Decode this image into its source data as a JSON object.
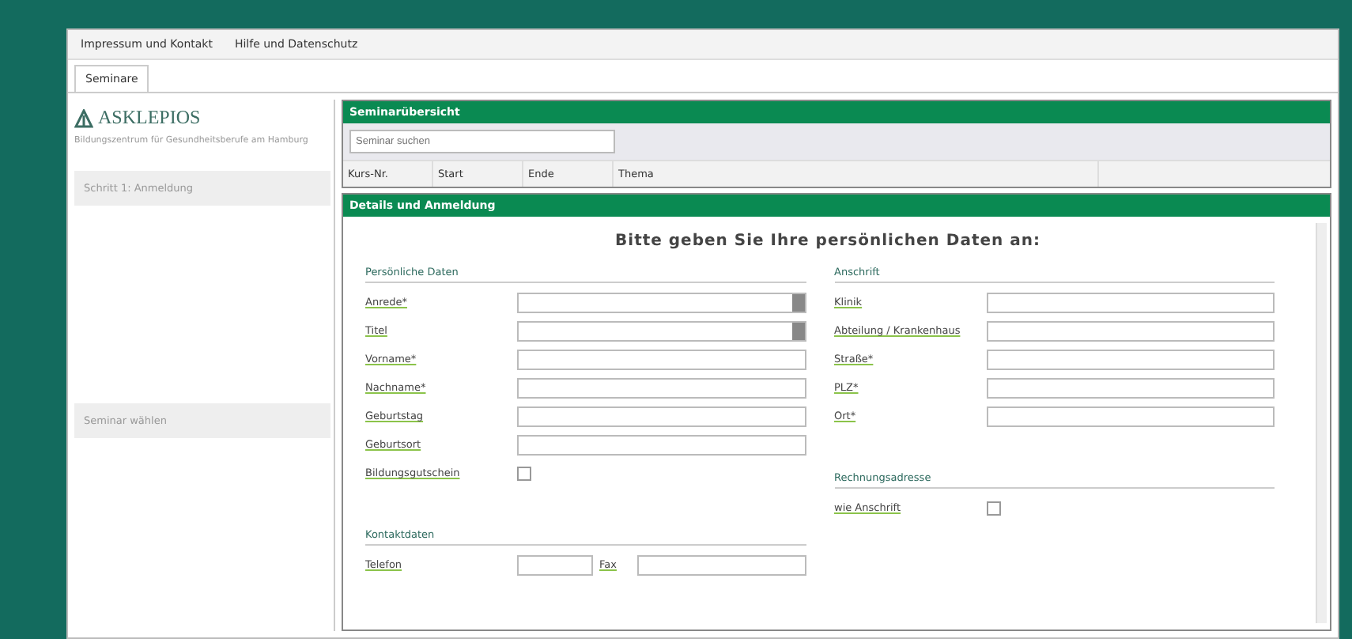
{
  "top_links": [
    "Impressum und Kontakt",
    "Hilfe und Datenschutz"
  ],
  "tabs": [
    {
      "label": "Seminare",
      "selected": true
    }
  ],
  "sidebar": {
    "logo": "ASKLEPIOS",
    "subtitle": "Bildungszentrum für Gesundheitsberufe am Hamburg",
    "sections": [
      "Schritt 1: Anmeldung",
      "Seminar wählen"
    ]
  },
  "seminars": {
    "title": "Seminarübersicht",
    "search": {
      "placeholder": "Seminar suchen"
    },
    "columns": [
      "Kurs-Nr.",
      "Start",
      "Ende",
      "Thema"
    ]
  },
  "details": {
    "title": "Details und Anmeldung",
    "heading": "Bitte geben Sie Ihre persönlichen Daten an:",
    "left": [
      {
        "title": "Persönliche Daten",
        "fields": [
          {
            "label": "Anrede*",
            "kind": "select"
          },
          {
            "label": "Titel",
            "kind": "select"
          },
          {
            "label": "Vorname*",
            "kind": "text"
          },
          {
            "label": "Nachname*",
            "kind": "text"
          },
          {
            "label": "Geburtstag",
            "kind": "text"
          },
          {
            "label": "Geburtsort",
            "kind": "text"
          },
          {
            "label": "Bildungsgutschein",
            "kind": "checkbox",
            "checked": false
          }
        ]
      },
      {
        "title": "Kontaktdaten",
        "fields": [
          {
            "label": "Telefon",
            "kind": "phone",
            "second_label": "Fax"
          }
        ]
      }
    ],
    "right": [
      {
        "title": "Anschrift",
        "fields": [
          {
            "label": "Klinik",
            "kind": "text"
          },
          {
            "label": "Abteilung / Krankenhaus",
            "kind": "text"
          },
          {
            "label": "Straße*",
            "kind": "text"
          },
          {
            "label": "PLZ*",
            "kind": "text"
          },
          {
            "label": "Ort*",
            "kind": "text"
          }
        ]
      },
      {
        "title": "Rechnungsadresse",
        "fields": [
          {
            "label": "wie Anschrift",
            "kind": "checkbox",
            "checked": false
          }
        ]
      }
    ]
  }
}
